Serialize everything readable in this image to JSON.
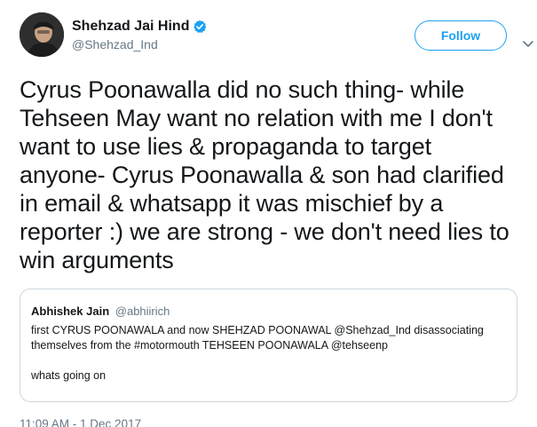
{
  "author": {
    "name": "Shehzad Jai Hind",
    "handle": "@Shehzad_Ind"
  },
  "follow_button": {
    "label": "Follow"
  },
  "tweet": {
    "text": "Cyrus Poonawalla did no such thing- while Tehseen May want no relation with me I don't want to use lies & propaganda to target anyone- Cyrus Poonawalla & son had clarified in email & whatsapp it was mischief by a reporter :) we are strong - we don't need lies to win arguments",
    "timestamp": "11:09 AM - 1 Dec 2017"
  },
  "quoted_tweet": {
    "name": "Abhishek Jain",
    "handle": "@abhiirich",
    "text": "first CYRUS POONAWALA and now SHEHZAD POONAWAL @Shehzad_Ind disassociating themselves from the #motormouth TEHSEEN POONAWALA @tehseenp\n\nwhats going on"
  },
  "icons": {
    "verified": "verified-badge-icon",
    "caret": "chevron-down-icon",
    "avatar": "profile-photo"
  },
  "colors": {
    "accent": "#1da1f2",
    "secondary_text": "#657786",
    "border": "#ccd6dd"
  }
}
